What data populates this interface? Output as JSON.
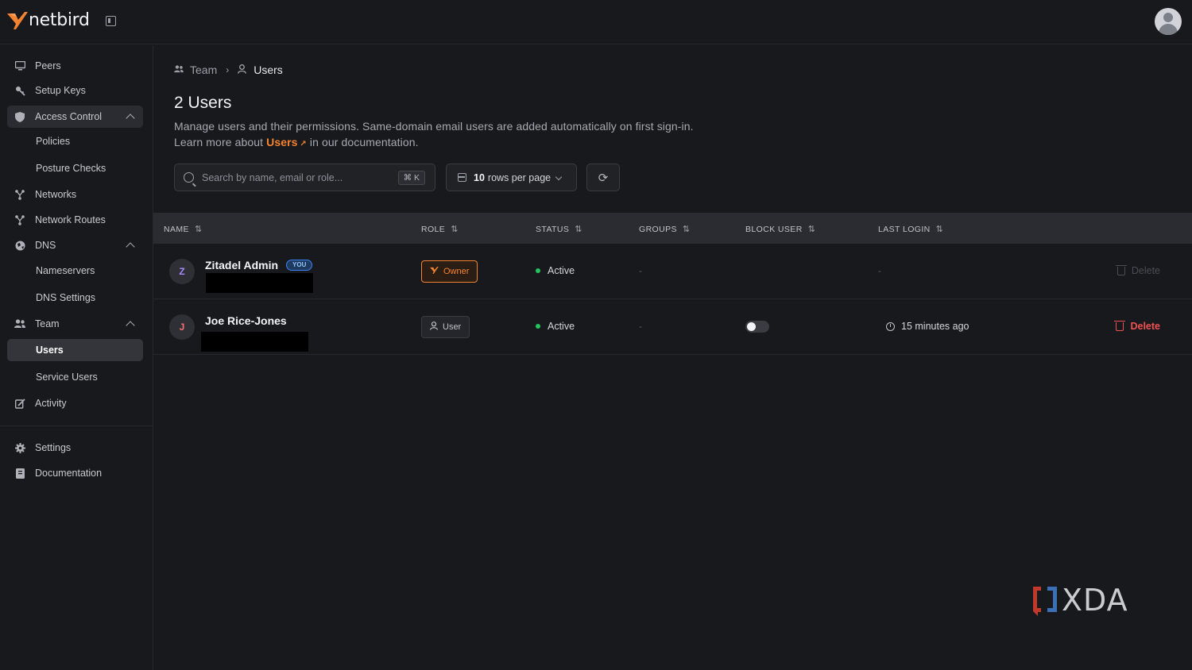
{
  "header": {
    "brand": "netbird",
    "colors": {
      "accent": "#f68330",
      "background": "#18191d"
    }
  },
  "sidebar": {
    "items": [
      {
        "label": "Peers",
        "icon": "monitor-icon"
      },
      {
        "label": "Setup Keys",
        "icon": "key-icon"
      },
      {
        "label": "Access Control",
        "icon": "shield-icon",
        "expanded": true
      },
      {
        "label": "Policies"
      },
      {
        "label": "Posture Checks"
      },
      {
        "label": "Networks",
        "icon": "network-icon"
      },
      {
        "label": "Network Routes",
        "icon": "route-icon"
      },
      {
        "label": "DNS",
        "icon": "globe-icon",
        "expanded": true
      },
      {
        "label": "Nameservers"
      },
      {
        "label": "DNS Settings"
      },
      {
        "label": "Team",
        "icon": "team-icon",
        "expanded": true
      },
      {
        "label": "Users",
        "selected": true
      },
      {
        "label": "Service Users"
      },
      {
        "label": "Activity",
        "icon": "activity-icon"
      },
      {
        "label": "Settings",
        "icon": "gear-icon"
      },
      {
        "label": "Documentation",
        "icon": "book-icon"
      }
    ]
  },
  "breadcrumb": {
    "parent": "Team",
    "current": "Users"
  },
  "page": {
    "title": "2 Users",
    "description_line1": "Manage users and their permissions. Same-domain email users are added automatically on first sign-in.",
    "description_line2_pre": "Learn more about",
    "description_link": "Users",
    "description_line2_post": "in our documentation."
  },
  "toolbar": {
    "search_placeholder": "Search by name, email or role...",
    "search_shortcut": "⌘ K",
    "rows_value": "10",
    "rows_suffix": "rows per page"
  },
  "table": {
    "columns": [
      "NAME",
      "ROLE",
      "STATUS",
      "GROUPS",
      "BLOCK USER",
      "LAST LOGIN"
    ],
    "rows": [
      {
        "initial": "Z",
        "name": "Zitadel Admin",
        "badge": "YOU",
        "role": "Owner",
        "status": "Active",
        "groups": "-",
        "last_login": "-",
        "action": "Delete",
        "action_enabled": false
      },
      {
        "initial": "J",
        "name": "Joe Rice-Jones",
        "role": "User",
        "status": "Active",
        "groups": "-",
        "blocked": false,
        "last_login": "15 minutes ago",
        "action": "Delete",
        "action_enabled": true
      }
    ]
  },
  "watermark": "XDA"
}
